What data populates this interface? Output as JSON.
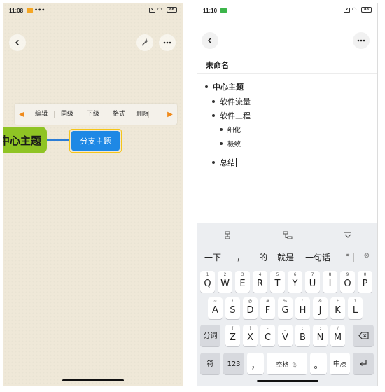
{
  "left_screen": {
    "status_time": "11:08",
    "status_dots": "•••",
    "battery": "88",
    "toolbar_items": [
      "编辑",
      "同级",
      "下级",
      "格式",
      "删除"
    ],
    "central_topic": "中心主题",
    "branch_topic": "分支主题",
    "colors": {
      "central": "#8fc424",
      "branch": "#1e88e5",
      "branch_border": "#f5c518",
      "toolbar_arrow": "#f08a1b"
    }
  },
  "right_screen": {
    "status_time": "11:10",
    "battery": "88",
    "doc_title": "未命名",
    "outline": [
      {
        "text": "中心主题",
        "level": 0
      },
      {
        "text": "软件流量",
        "level": 1
      },
      {
        "text": "软件工程",
        "level": 1
      },
      {
        "text": "细化",
        "level": 2
      },
      {
        "text": "极致",
        "level": 2
      },
      {
        "text": "总结",
        "level": 1
      }
    ],
    "candidates": [
      "一下",
      "，",
      "的",
      "就是",
      "一句话"
    ],
    "keys": {
      "row1": [
        {
          "main": "Q",
          "sub": "1"
        },
        {
          "main": "W",
          "sub": "2"
        },
        {
          "main": "E",
          "sub": "3"
        },
        {
          "main": "R",
          "sub": "4"
        },
        {
          "main": "T",
          "sub": "5"
        },
        {
          "main": "Y",
          "sub": "6"
        },
        {
          "main": "U",
          "sub": "7"
        },
        {
          "main": "I",
          "sub": "8"
        },
        {
          "main": "O",
          "sub": "9"
        },
        {
          "main": "P",
          "sub": "0"
        }
      ],
      "row2": [
        {
          "main": "A",
          "sub": "~"
        },
        {
          "main": "S",
          "sub": "!"
        },
        {
          "main": "D",
          "sub": "@"
        },
        {
          "main": "F",
          "sub": "#"
        },
        {
          "main": "G",
          "sub": "%"
        },
        {
          "main": "H",
          "sub": "'"
        },
        {
          "main": "J",
          "sub": "&"
        },
        {
          "main": "K",
          "sub": "*"
        },
        {
          "main": "L",
          "sub": "?"
        }
      ],
      "row3": [
        {
          "main": "Z",
          "sub": "("
        },
        {
          "main": "X",
          "sub": ")"
        },
        {
          "main": "C",
          "sub": "-"
        },
        {
          "main": "V",
          "sub": "_"
        },
        {
          "main": "B",
          "sub": ":"
        },
        {
          "main": "N",
          "sub": ";"
        },
        {
          "main": "M",
          "sub": "/"
        }
      ],
      "segment": "分词",
      "symbol": "符",
      "numbers": "123",
      "comma": "，",
      "space": "空格",
      "period": "。",
      "lang_main": "中",
      "lang_sub": "/英"
    }
  }
}
